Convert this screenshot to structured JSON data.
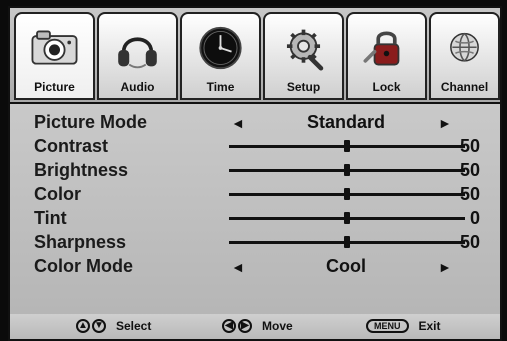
{
  "tabs": [
    {
      "label": "Picture",
      "icon": "camera-icon",
      "active": true
    },
    {
      "label": "Audio",
      "icon": "headphones-icon",
      "active": false
    },
    {
      "label": "Time",
      "icon": "clock-icon",
      "active": false
    },
    {
      "label": "Setup",
      "icon": "gear-icon",
      "active": false
    },
    {
      "label": "Lock",
      "icon": "lock-icon",
      "active": false
    },
    {
      "label": "Channel",
      "icon": "globe-icon",
      "active": false
    }
  ],
  "settings": {
    "picture_mode": {
      "label": "Picture Mode",
      "value": "Standard"
    },
    "contrast": {
      "label": "Contrast",
      "value": "50",
      "level": 50
    },
    "brightness": {
      "label": "Brightness",
      "value": "50",
      "level": 50
    },
    "color": {
      "label": "Color",
      "value": "50",
      "level": 50
    },
    "tint": {
      "label": "Tint",
      "value": "0",
      "level": 50
    },
    "sharpness": {
      "label": "Sharpness",
      "value": "50",
      "level": 50
    },
    "color_mode": {
      "label": "Color Mode",
      "value": "Cool"
    }
  },
  "help": {
    "select": {
      "label": "Select",
      "keys": "▲▼"
    },
    "move": {
      "label": "Move",
      "keys": "◀▶"
    },
    "exit": {
      "label": "Exit",
      "key": "MENU"
    }
  },
  "arrows": {
    "left": "◄",
    "right": "►"
  }
}
